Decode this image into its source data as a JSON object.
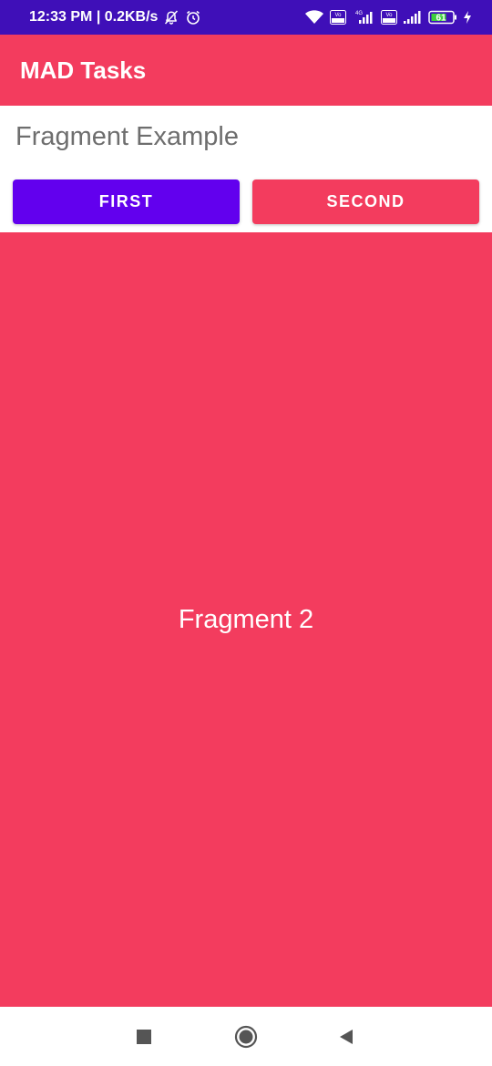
{
  "status_bar": {
    "time": "12:33 PM | 0.2KB/s",
    "battery": "61",
    "network_1": "4G",
    "volte_1": "Vo",
    "volte_2": "Vo",
    "background": "#3f0fb8",
    "icons": [
      "mute-notification-icon",
      "alarm-icon",
      "wifi-icon",
      "volte-icon",
      "signal-icon",
      "volte-icon",
      "signal-icon",
      "battery-icon",
      "charging-icon"
    ]
  },
  "app_bar": {
    "title": "MAD Tasks",
    "color": "#f33c5e"
  },
  "main": {
    "heading": "Fragment Example",
    "buttons": [
      {
        "label": "FIRST",
        "color": "#6200ee"
      },
      {
        "label": "SECOND",
        "color": "#f33c5e"
      }
    ],
    "fragment": {
      "label": "Fragment 2",
      "color": "#f33c5e"
    }
  },
  "nav_bar": {
    "icons": [
      "recents-icon",
      "home-icon",
      "back-icon"
    ]
  }
}
